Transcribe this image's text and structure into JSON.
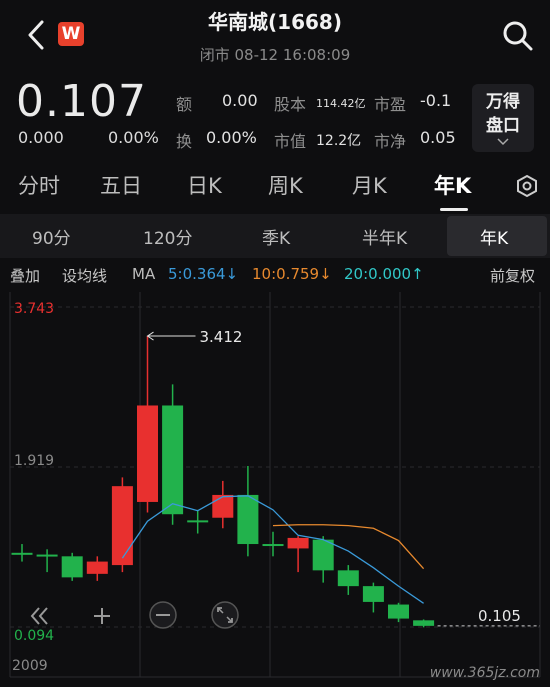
{
  "header": {
    "title": "华南城(1668)",
    "subtitle": "闭市 08-12 16:08:09",
    "logo_letter": "W",
    "back_icon": "chevron-left-icon",
    "search_icon": "search-icon"
  },
  "quote": {
    "price": "0.107",
    "change": "0.000",
    "change_pct": "0.00%",
    "amount_label": "额",
    "amount_value": "0.00",
    "shares_label": "股本",
    "shares_value": "114.42亿",
    "pe_label": "市盈",
    "pe_value": "-0.1",
    "turnover_label": "换",
    "turnover_value": "0.00%",
    "mcap_label": "市值",
    "mcap_value": "12.2亿",
    "pb_label": "市净",
    "pb_value": "0.05",
    "wind_btn_line1": "万得",
    "wind_btn_line2": "盘口"
  },
  "tabs": [
    "分时",
    "五日",
    "日K",
    "周K",
    "月K",
    "年K"
  ],
  "active_tab": "年K",
  "sub_tabs": [
    "90分",
    "120分",
    "季K",
    "半年K",
    "年K"
  ],
  "active_sub_tab": "年K",
  "indicators": {
    "overlay": "叠加",
    "settings": "设均线",
    "ma_label": "MA",
    "ma5": "5:0.364↓",
    "ma10": "10:0.759↓",
    "ma20": "20:0.000↑",
    "adjust": "前复权"
  },
  "colors": {
    "up": "#e8302f",
    "down": "#22b24c",
    "ma5": "#3a9ad9",
    "ma10": "#e7892e",
    "ma20": "#31c8c8",
    "bg": "#0e0e10"
  },
  "chart_data": {
    "type": "candlestick",
    "y_max_label": "3.743",
    "y_mid_label": "1.919",
    "y_min_label": "0.094",
    "ylim": [
      0.094,
      3.743
    ],
    "x_start_label": "2009",
    "high_annotation": "3.412",
    "last_annotation": "0.105",
    "candles": [
      {
        "o": 0.94,
        "c": 0.94,
        "h": 1.04,
        "l": 0.84
      },
      {
        "o": 0.92,
        "c": 0.92,
        "h": 0.98,
        "l": 0.72
      },
      {
        "o": 0.9,
        "c": 0.66,
        "h": 0.94,
        "l": 0.62
      },
      {
        "o": 0.7,
        "c": 0.84,
        "h": 0.9,
        "l": 0.62
      },
      {
        "o": 0.8,
        "c": 1.7,
        "h": 1.8,
        "l": 0.72
      },
      {
        "o": 1.52,
        "c": 2.62,
        "h": 3.412,
        "l": 1.4
      },
      {
        "o": 2.62,
        "c": 1.38,
        "h": 2.86,
        "l": 1.26
      },
      {
        "o": 1.31,
        "c": 1.31,
        "h": 1.43,
        "l": 1.16
      },
      {
        "o": 1.34,
        "c": 1.6,
        "h": 1.76,
        "l": 1.22
      },
      {
        "o": 1.6,
        "c": 1.04,
        "h": 1.93,
        "l": 0.9
      },
      {
        "o": 1.04,
        "c": 1.04,
        "h": 1.18,
        "l": 0.9
      },
      {
        "o": 0.99,
        "c": 1.11,
        "h": 1.13,
        "l": 0.72
      },
      {
        "o": 1.09,
        "c": 0.74,
        "h": 1.13,
        "l": 0.6
      },
      {
        "o": 0.74,
        "c": 0.56,
        "h": 0.8,
        "l": 0.46
      },
      {
        "o": 0.56,
        "c": 0.38,
        "h": 0.6,
        "l": 0.26
      },
      {
        "o": 0.35,
        "c": 0.19,
        "h": 0.37,
        "l": 0.15
      },
      {
        "o": 0.17,
        "c": 0.107,
        "h": 0.18,
        "l": 0.09
      }
    ],
    "ma5": [
      null,
      null,
      null,
      null,
      0.88,
      1.3,
      1.5,
      1.42,
      1.58,
      1.59,
      1.43,
      1.14,
      1.09,
      0.96,
      0.77,
      0.56,
      0.364
    ],
    "ma10": [
      null,
      null,
      null,
      null,
      null,
      null,
      null,
      null,
      null,
      null,
      1.25,
      1.26,
      1.26,
      1.25,
      1.22,
      1.08,
      0.759
    ]
  },
  "controls": [
    "collapse-icon",
    "zoom-in-icon",
    "zoom-out-icon",
    "fullscreen-icon"
  ],
  "watermark": "www.365jz.com"
}
